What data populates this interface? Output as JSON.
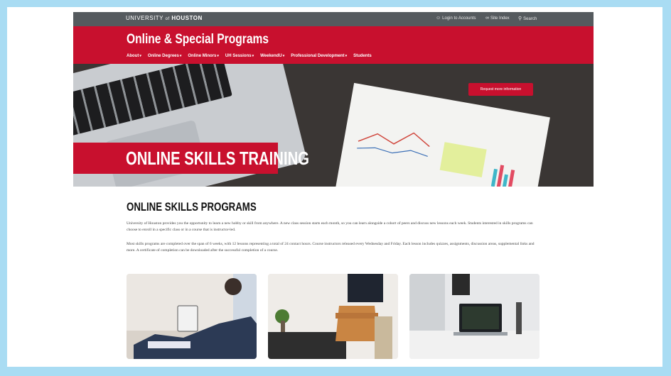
{
  "header": {
    "university_pre": "UNIVERSITY",
    "university_of": "of",
    "university_post": "HOUSTON",
    "utility": [
      {
        "icon": "user-icon",
        "label": "Login to Accounts"
      },
      {
        "icon": "link-icon",
        "label": "Site Index"
      },
      {
        "icon": "search-icon",
        "label": "Search"
      }
    ]
  },
  "site_title": "Online & Special Programs",
  "nav": [
    "About",
    "Online Degrees",
    "Online Minors",
    "UH Sessions",
    "WeekendU",
    "Professional Development",
    "Students"
  ],
  "hero": {
    "cta_label": "Request more information",
    "banner_title": "ONLINE SKILLS TRAINING"
  },
  "main": {
    "heading": "ONLINE SKILLS PROGRAMS",
    "paragraph_1": "University of Houston provides you the opportunity to learn a new hobby or skill from anywhere. A new class session starts each month, so you can learn alongside a cohort of peers and discuss new lessons each week. Students interested in skills programs can choose to enroll in a specific class or in a course that is instructor-led.",
    "paragraph_2": "Most skills programs are completed over the span of 6 weeks, with 12 lessons representing a total of 24 contact hours. Course instructors released every Wednesday and Friday. Each lesson includes quizzes, assignments, discussion areas, supplemental links and more. A certificate of completion can be downloaded after the successful completion of a course."
  },
  "colors": {
    "frame_border": "#a9dcf3",
    "brand_red": "#c8102e",
    "topbar_gray": "#555a5e"
  }
}
